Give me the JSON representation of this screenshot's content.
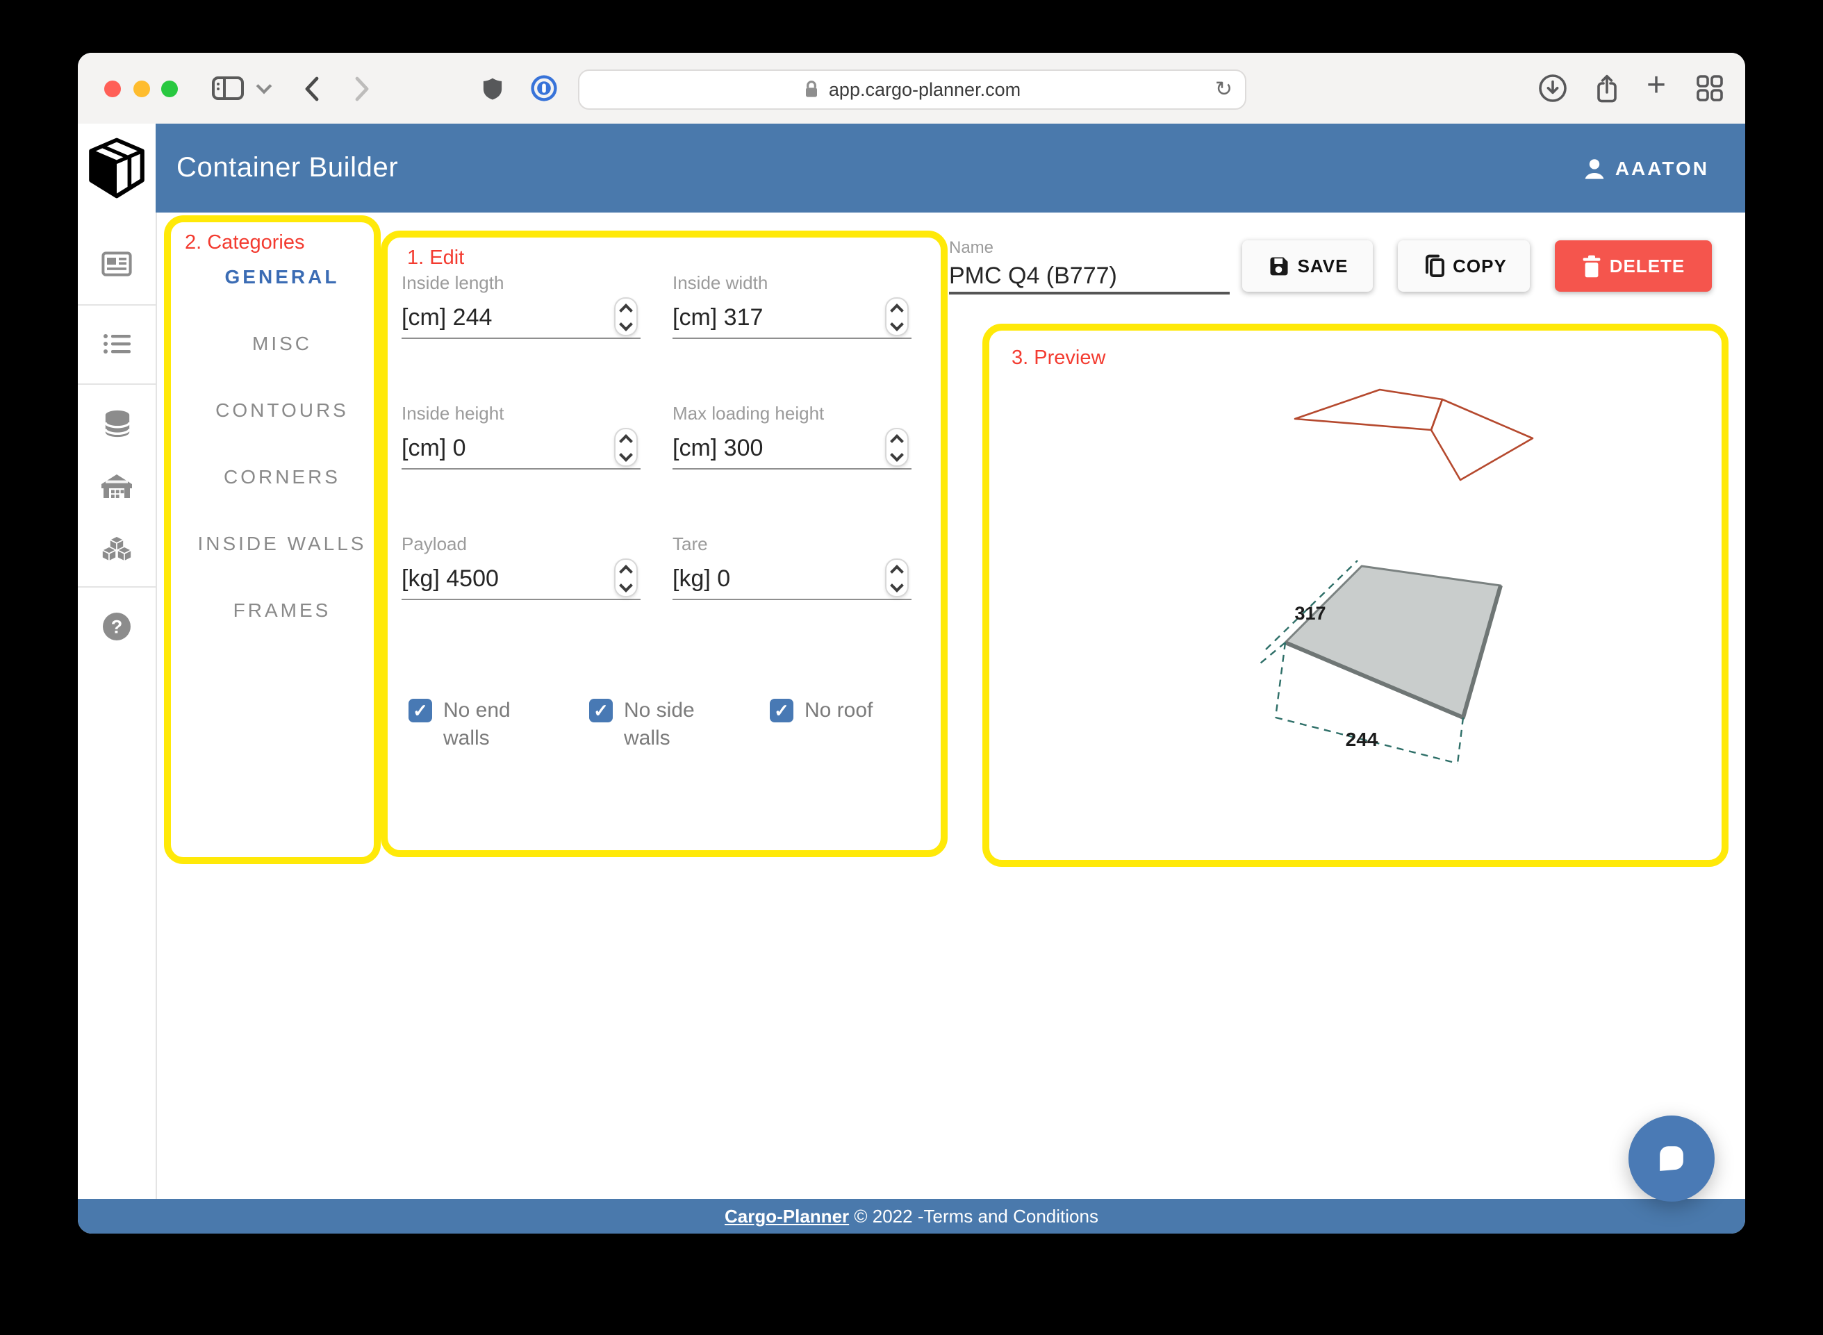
{
  "browser": {
    "url": "app.cargo-planner.com"
  },
  "header": {
    "title": "Container Builder",
    "user": "AAATON"
  },
  "annotations": {
    "edit": "1. Edit",
    "categories": "2. Categories",
    "preview": "3. Preview",
    "highlight_color": "#ffe908",
    "label_color": "#f33b30"
  },
  "categories": {
    "items": [
      {
        "label": "GENERAL",
        "active": true
      },
      {
        "label": "MISC",
        "active": false
      },
      {
        "label": "CONTOURS",
        "active": false
      },
      {
        "label": "CORNERS",
        "active": false
      },
      {
        "label": "INSIDE WALLS",
        "active": false
      },
      {
        "label": "FRAMES",
        "active": false
      }
    ]
  },
  "edit_form": {
    "fields": [
      {
        "label": "Inside length",
        "value": "[cm] 244"
      },
      {
        "label": "Inside width",
        "value": "[cm] 317"
      },
      {
        "label": "Inside height",
        "value": "[cm] 0"
      },
      {
        "label": "Max loading height",
        "value": "[cm] 300"
      },
      {
        "label": "Payload",
        "value": "[kg] 4500"
      },
      {
        "label": "Tare",
        "value": "[kg] 0"
      }
    ],
    "checkboxes": [
      {
        "label": "No end walls",
        "checked": true
      },
      {
        "label": "No side walls",
        "checked": true
      },
      {
        "label": "No roof",
        "checked": true
      }
    ]
  },
  "container": {
    "name_label": "Name",
    "name": "PMC Q4 (B777)"
  },
  "actions": {
    "save": "SAVE",
    "copy": "COPY",
    "delete": "DELETE"
  },
  "preview": {
    "width_dim": "317",
    "length_dim": "244"
  },
  "footer": {
    "link": "Cargo-Planner",
    "rest": " © 2022 -Terms and Conditions"
  },
  "glyphs": {
    "refresh": "↻",
    "plus": "+",
    "check": "✓",
    "question": "?"
  }
}
